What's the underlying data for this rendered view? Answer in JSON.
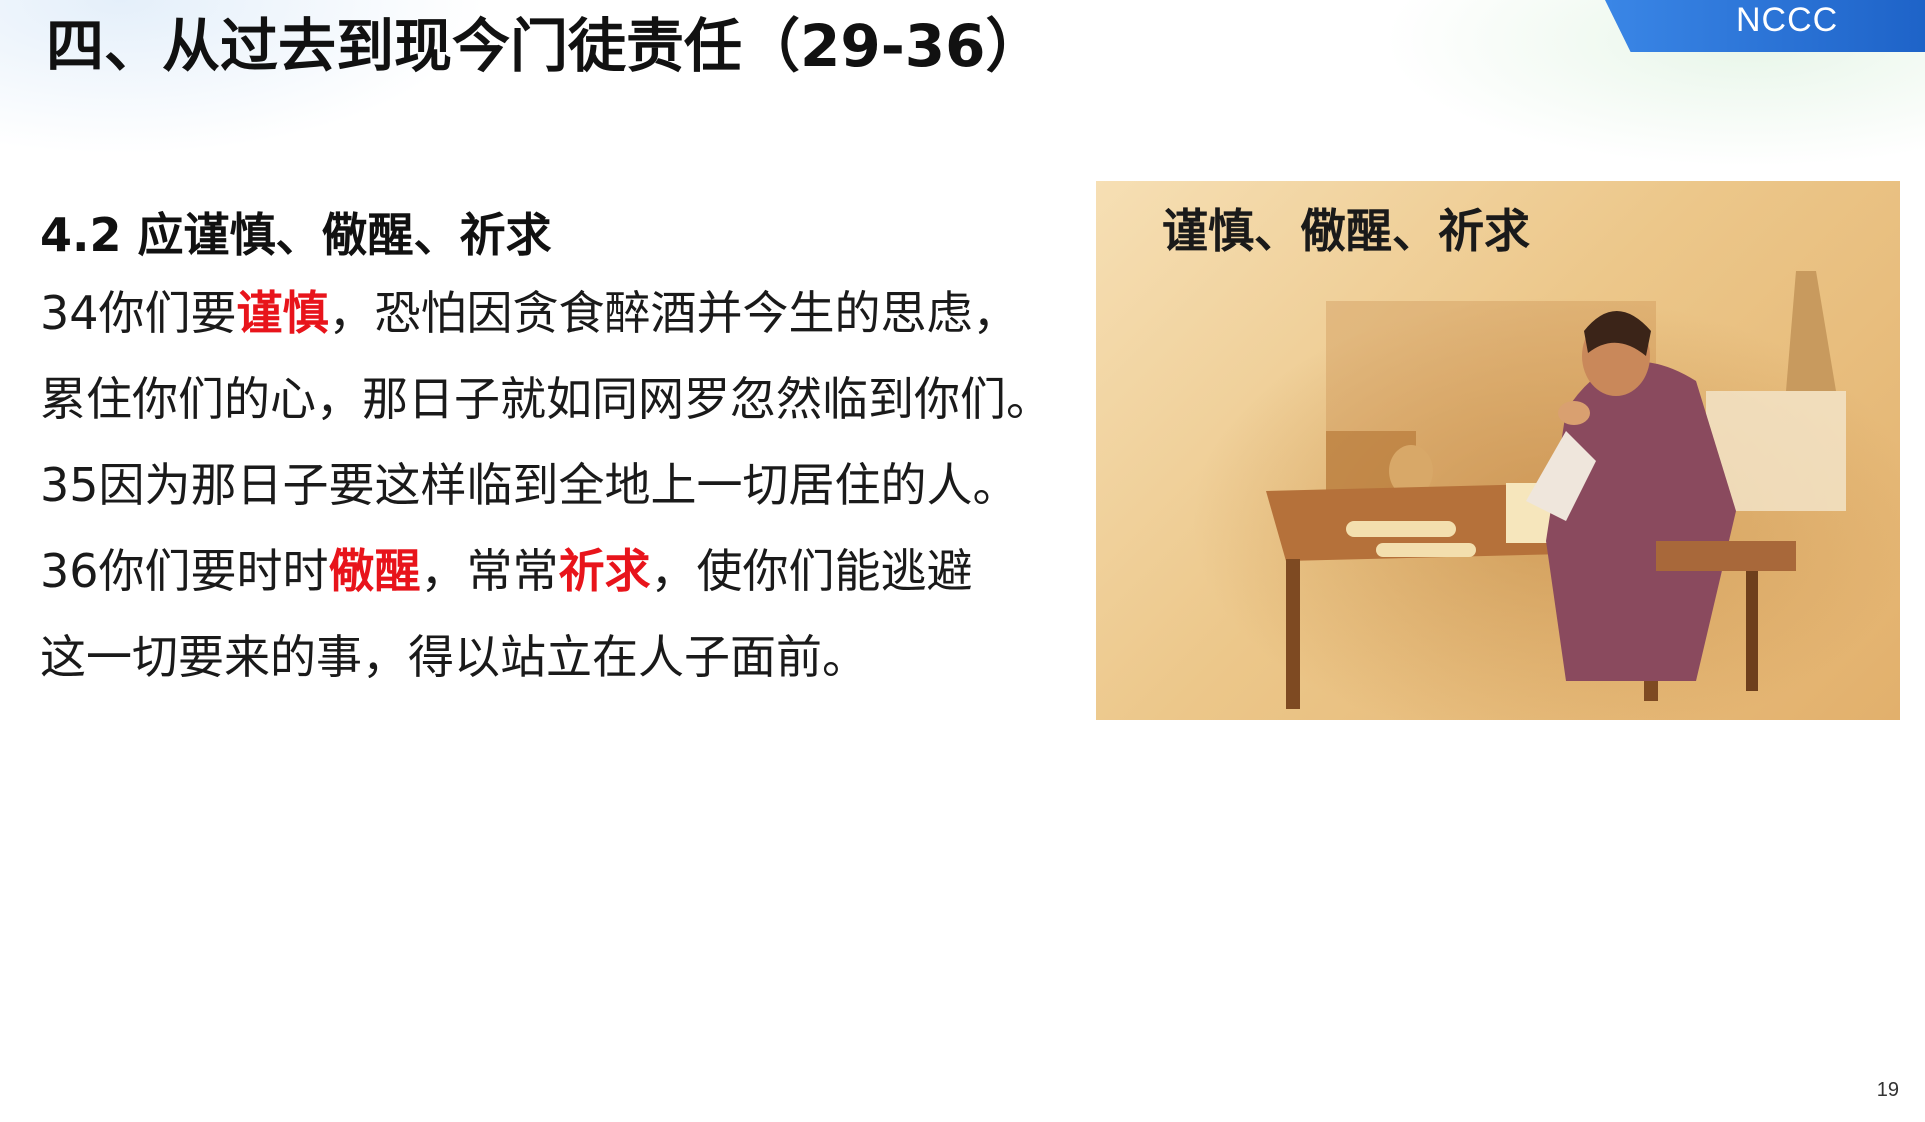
{
  "slide": {
    "title": "四、从过去到现今门徒责任（29-36）",
    "badge": "NCCC",
    "page_number": "19"
  },
  "section": {
    "heading": "4.2 应谨慎、儆醒、祈求",
    "verse34a": {
      "before": "34你们要",
      "highlight": "谨慎",
      "after": "，恐怕因贪食醉酒并今生的思虑，"
    },
    "verse34b": "累住你们的心，那日子就如同网罗忽然临到你们。",
    "verse35": "35因为那日子要这样临到全地上一切居住的人。",
    "verse36a": {
      "before": "36你们要时时",
      "highlight1": "儆醒",
      "middle": "，常常",
      "highlight2": "祈求",
      "after": "，使你们能逃避"
    },
    "verse36b": "这一切要来的事，得以站立在人子面前。"
  },
  "illustration": {
    "caption": "谨慎、儆醒、祈求",
    "image_icon": "praying-man-at-table-illustration"
  },
  "colors": {
    "highlight": "#e8141b",
    "badge": "#2f78dc",
    "text": "#111111"
  }
}
